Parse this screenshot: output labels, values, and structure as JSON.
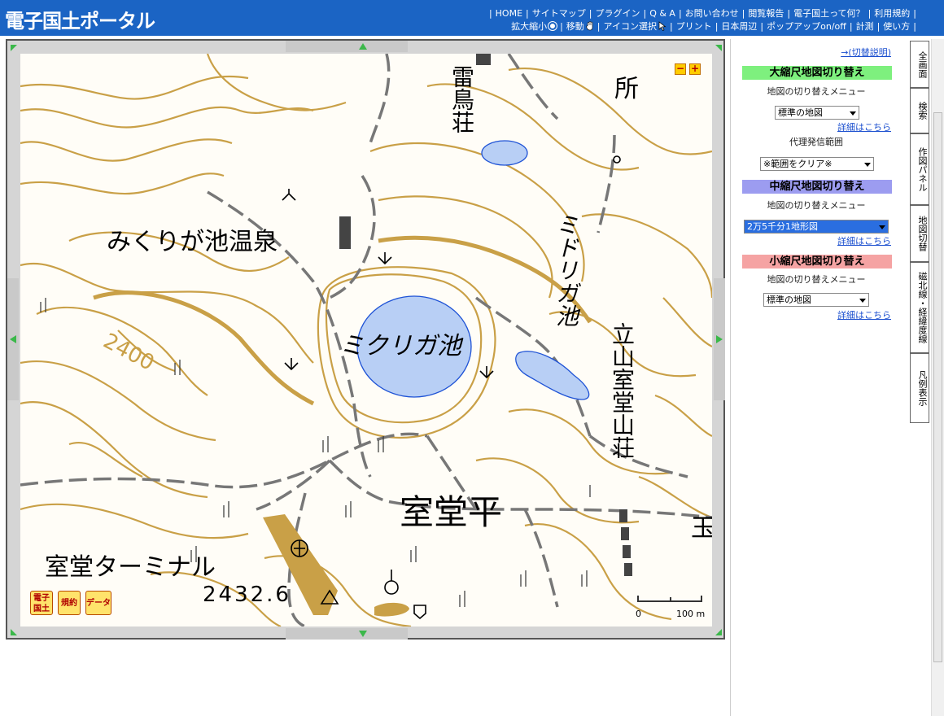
{
  "header": {
    "logo": "電子国土ポータル",
    "nav_top": [
      "HOME",
      "サイトマップ",
      "プラグイン",
      "Q & A",
      "お問い合わせ",
      "閲覧報告",
      "電子国土って何？",
      "利用規約"
    ],
    "nav_bottom": [
      "拡大縮小",
      "移動",
      "アイコン選択",
      "プリント",
      "日本周辺",
      "ポップアップon/off",
      "計測",
      "使い方"
    ]
  },
  "map": {
    "labels": {
      "raichoso": "雷鳥荘",
      "tokoro": "所",
      "mikurigaike_onsen": "みくりが池温泉",
      "midorigaike": "ミドリガ池",
      "mikurigaike": "ミクリガ池",
      "tateyama_murodo_sanso": "立山室堂山荘",
      "murodo_daira": "室堂平",
      "murodo_terminal": "室堂ターミナル",
      "elevation": "2432.6",
      "contour_2400": "2400",
      "tama": "玉",
      "scale_zero": "0",
      "scale_100m": "100 m"
    },
    "badges": [
      "電子国土",
      "規約",
      "データ"
    ],
    "zoom_minus": "−",
    "zoom_plus": "+"
  },
  "sidebar": {
    "switch_help": "→(切替説明)",
    "large": {
      "title": "大縮尺地図切り替え",
      "menu_label": "地図の切り替えメニュー",
      "selected": "標準の地図",
      "details": "詳細はこちら",
      "proxy_label": "代理発信範囲",
      "proxy_selected": "※範囲をクリア※",
      "color": "#7ef07e"
    },
    "medium": {
      "title": "中縮尺地図切り替え",
      "menu_label": "地図の切り替えメニュー",
      "selected": "2万5千分1地形図",
      "details": "詳細はこちら",
      "color": "#9c9cf0"
    },
    "small": {
      "title": "小縮尺地図切り替え",
      "menu_label": "地図の切り替えメニュー",
      "selected": "標準の地図",
      "details": "詳細はこちら",
      "color": "#f5a3a3"
    }
  },
  "tabs": [
    "全画面",
    "検索",
    "作図パネル",
    "地図切替",
    "磁北線・経緯度線",
    "凡例表示"
  ],
  "colors": {
    "header_bg": "#1b64c4",
    "contour": "#c9a047",
    "water": "#b8cff5",
    "water_edge": "#1f53d6",
    "trail": "#666666"
  }
}
